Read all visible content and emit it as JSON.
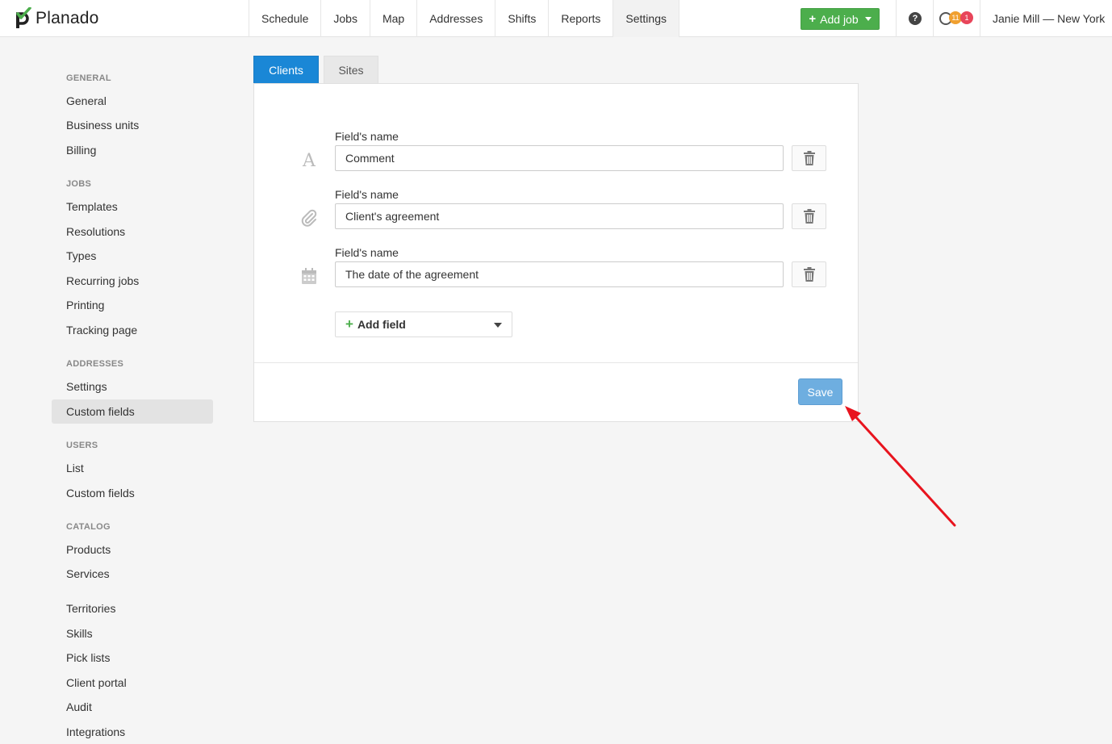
{
  "app": {
    "logo_text": "Planado"
  },
  "nav": {
    "items": [
      {
        "label": "Schedule"
      },
      {
        "label": "Jobs"
      },
      {
        "label": "Map"
      },
      {
        "label": "Addresses"
      },
      {
        "label": "Shifts"
      },
      {
        "label": "Reports"
      },
      {
        "label": "Settings"
      }
    ],
    "add_job_label": "Add job",
    "help_glyph": "?",
    "notifications": {
      "orange_count": "11",
      "red_count": "1"
    },
    "user_label": "Janie Mill — New York"
  },
  "sidebar": {
    "sections": [
      {
        "heading": "GENERAL",
        "items": [
          "General",
          "Business units",
          "Billing"
        ]
      },
      {
        "heading": "JOBS",
        "items": [
          "Templates",
          "Resolutions",
          "Types",
          "Recurring jobs",
          "Printing",
          "Tracking page"
        ]
      },
      {
        "heading": "ADDRESSES",
        "items": [
          "Settings",
          "Custom fields"
        ]
      },
      {
        "heading": "USERS",
        "items": [
          "List",
          "Custom fields"
        ]
      },
      {
        "heading": "CATALOG",
        "items": [
          "Products",
          "Services"
        ]
      },
      {
        "heading": "",
        "items": [
          "Territories",
          "Skills",
          "Pick lists",
          "Client portal",
          "Audit",
          "Integrations"
        ]
      }
    ],
    "active_item": "Custom fields"
  },
  "tabs": {
    "clients": "Clients",
    "sites": "Sites"
  },
  "custom_fields": [
    {
      "label": "Field's name",
      "value": "Comment",
      "type_icon": "text-type-icon"
    },
    {
      "label": "Field's name",
      "value": "Client's agreement",
      "type_icon": "attachment-icon"
    },
    {
      "label": "Field's name",
      "value": "The date of the agreement",
      "type_icon": "calendar-icon"
    }
  ],
  "add_field_label": "Add field",
  "save_label": "Save",
  "colors": {
    "primary_tab": "#1a87d6",
    "add_job_green": "#4cae4c",
    "save_button": "#6eaee0",
    "annotation_arrow": "#e8141e"
  }
}
